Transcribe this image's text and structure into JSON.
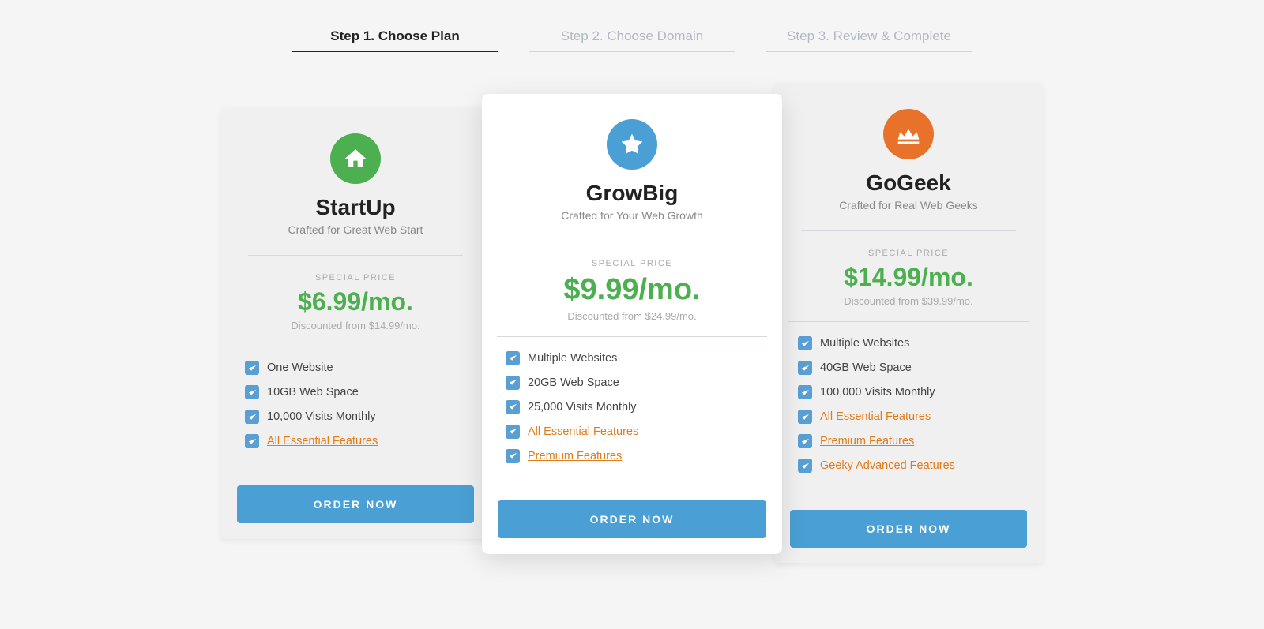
{
  "steps": [
    {
      "id": "step1",
      "label": "Step 1. Choose Plan",
      "active": true
    },
    {
      "id": "step2",
      "label": "Step 2. Choose Domain",
      "active": false
    },
    {
      "id": "step3",
      "label": "Step 3. Review & Complete",
      "active": false
    }
  ],
  "plans": [
    {
      "id": "startup",
      "icon": "house",
      "icon_color": "green",
      "name": "StartUp",
      "tagline": "Crafted for Great Web Start",
      "special_price_label": "SPECIAL PRICE",
      "price": "$6.99/mo.",
      "price_original": "Discounted from $14.99/mo.",
      "features": [
        {
          "text": "One Website",
          "link": false
        },
        {
          "text": "10GB Web Space",
          "link": false
        },
        {
          "text": "10,000 Visits Monthly",
          "link": false
        },
        {
          "text": "All Essential Features",
          "link": true
        }
      ],
      "cta": "ORDER NOW",
      "featured": false
    },
    {
      "id": "growbig",
      "icon": "star",
      "icon_color": "blue",
      "name": "GrowBig",
      "tagline": "Crafted for Your Web Growth",
      "special_price_label": "SPECIAL PRICE",
      "price": "$9.99/mo.",
      "price_original": "Discounted from $24.99/mo.",
      "features": [
        {
          "text": "Multiple Websites",
          "link": false
        },
        {
          "text": "20GB Web Space",
          "link": false
        },
        {
          "text": "25,000 Visits Monthly",
          "link": false
        },
        {
          "text": "All Essential Features",
          "link": true
        },
        {
          "text": "Premium Features",
          "link": true
        }
      ],
      "cta": "ORDER NOW",
      "featured": true
    },
    {
      "id": "gogeek",
      "icon": "crown",
      "icon_color": "orange",
      "name": "GoGeek",
      "tagline": "Crafted for Real Web Geeks",
      "special_price_label": "SPECIAL PRICE",
      "price": "$14.99/mo.",
      "price_original": "Discounted from $39.99/mo.",
      "features": [
        {
          "text": "Multiple Websites",
          "link": false
        },
        {
          "text": "40GB Web Space",
          "link": false
        },
        {
          "text": "100,000 Visits Monthly",
          "link": false
        },
        {
          "text": "All Essential Features",
          "link": true
        },
        {
          "text": "Premium Features",
          "link": true
        },
        {
          "text": "Geeky Advanced Features",
          "link": true
        }
      ],
      "cta": "ORDER NOW",
      "featured": false
    }
  ]
}
